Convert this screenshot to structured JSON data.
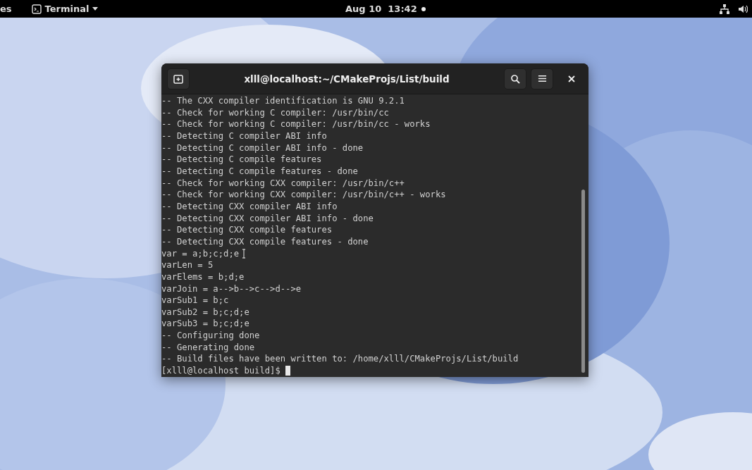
{
  "top_bar": {
    "activities": "es",
    "app_menu": {
      "label": "Terminal"
    },
    "clock": "Aug 10  13:42"
  },
  "window": {
    "title": "xlll@localhost:~/CMakeProjs/List/build",
    "lines": [
      "-- The CXX compiler identification is GNU 9.2.1",
      "-- Check for working C compiler: /usr/bin/cc",
      "-- Check for working C compiler: /usr/bin/cc - works",
      "-- Detecting C compiler ABI info",
      "-- Detecting C compiler ABI info - done",
      "-- Detecting C compile features",
      "-- Detecting C compile features - done",
      "-- Check for working CXX compiler: /usr/bin/c++",
      "-- Check for working CXX compiler: /usr/bin/c++ - works",
      "-- Detecting CXX compiler ABI info",
      "-- Detecting CXX compiler ABI info - done",
      "-- Detecting CXX compile features",
      "-- Detecting CXX compile features - done",
      "var = a;b;c;d;e",
      "varLen = 5",
      "varElems = b;d;e",
      "varJoin = a-->b-->c-->d-->e",
      "varSub1 = b;c",
      "varSub2 = b;c;d;e",
      "varSub3 = b;c;d;e",
      "-- Configuring done",
      "-- Generating done",
      "-- Build files have been written to: /home/xlll/CMakeProjs/List/build"
    ],
    "prompt": "[xlll@localhost build]$"
  }
}
